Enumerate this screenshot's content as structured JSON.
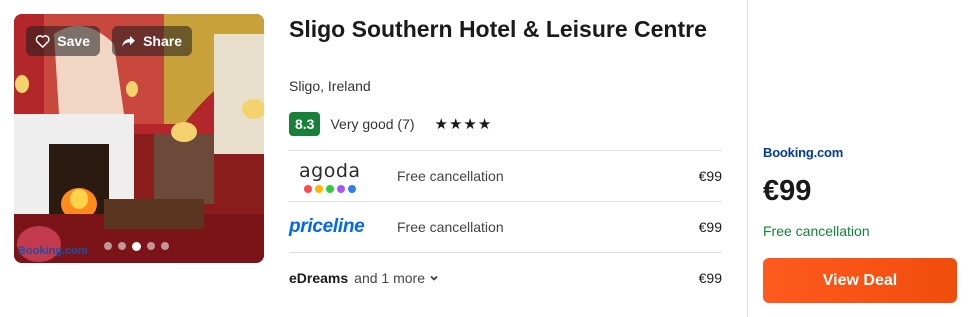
{
  "hotel": {
    "name": "Sligo Southern Hotel & Leisure Centre",
    "location": "Sligo, Ireland",
    "score": "8.3",
    "rating_text": "Very good (7)",
    "stars": "★★★★",
    "star_count": 4
  },
  "photo": {
    "save_label": "Save",
    "share_label": "Share",
    "watermark": "Booking.com",
    "slide_count": 5,
    "active_slide": 2
  },
  "providers": [
    {
      "name": "agoda",
      "note": "Free cancellation",
      "price": "€99"
    },
    {
      "name": "priceline",
      "note": "Free cancellation",
      "price": "€99"
    },
    {
      "name": "eDreams",
      "more": "and 1 more",
      "price": "€99"
    }
  ],
  "featured": {
    "provider": "Booking.com",
    "price": "€99",
    "note": "Free cancellation",
    "cta": "View Deal"
  },
  "colors": {
    "score_bg": "#188038",
    "cta": "#ff5a1f",
    "booking_blue": "#003b95",
    "priceline_blue": "#0068ef",
    "agoda_dots": [
      "#ff4b4b",
      "#ffb400",
      "#2ecc40",
      "#a855f7",
      "#2f80ed"
    ]
  }
}
